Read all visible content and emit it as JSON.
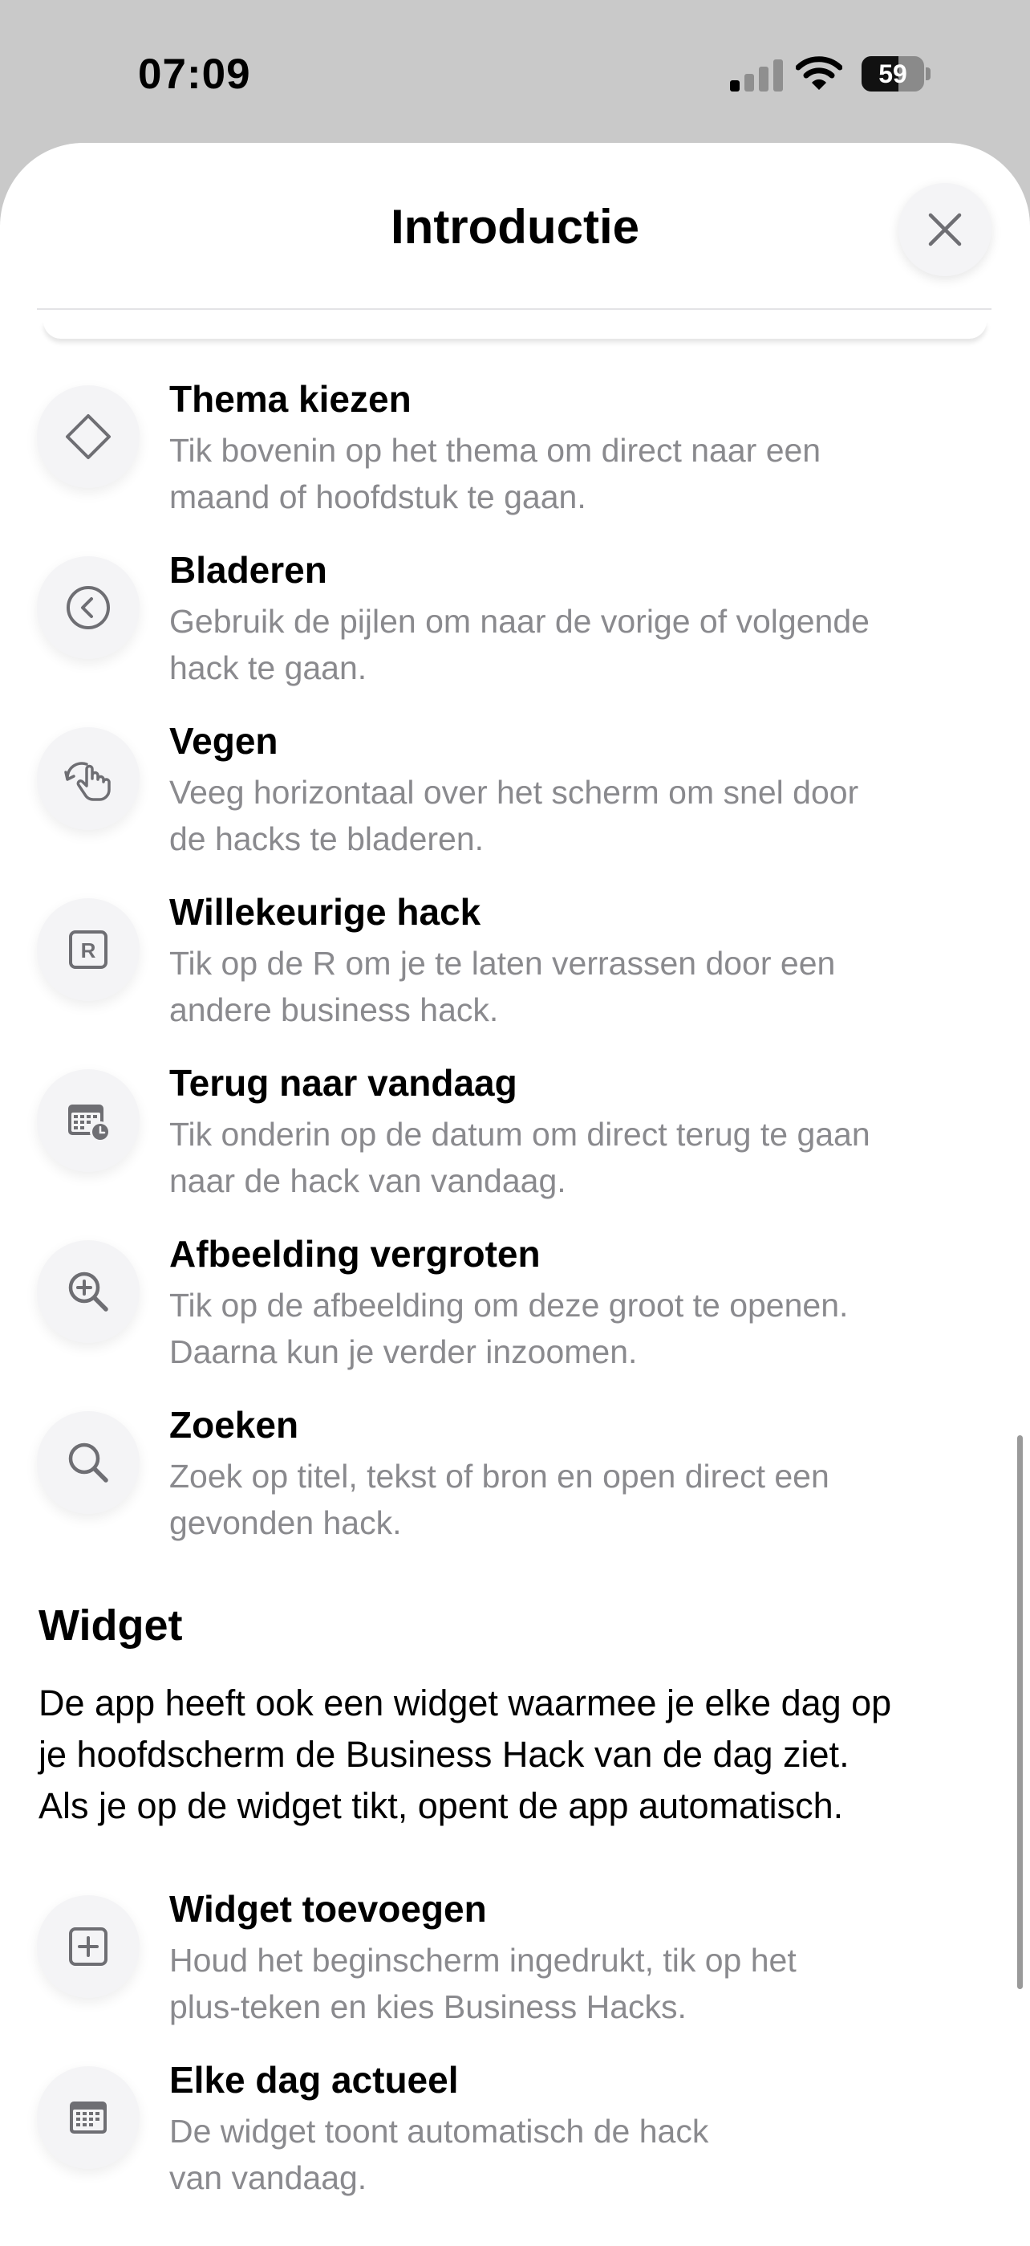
{
  "status_bar": {
    "time": "07:09",
    "battery": "59",
    "battery_level": 0.59
  },
  "sheet": {
    "title": "Introductie",
    "close_icon": "close-icon"
  },
  "items": [
    {
      "icon": "diamond-icon",
      "title": "Thema kiezen",
      "desc_1": "Tik bovenin op het thema om direct naar een",
      "desc_2": "maand of hoofdstuk te gaan."
    },
    {
      "icon": "chevron-left-circle-icon",
      "title": "Bladeren",
      "desc_1": "Gebruik de pijlen om naar de vorige of volgende",
      "desc_2": "hack te gaan."
    },
    {
      "icon": "swipe-hand-icon",
      "title": "Vegen",
      "desc_1": "Veeg horizontaal over het scherm om snel door",
      "desc_2": "de hacks te bladeren."
    },
    {
      "icon": "r-square-icon",
      "title": "Willekeurige hack",
      "desc_1": "Tik op de R om je te laten verrassen door een",
      "desc_2": "andere business hack."
    },
    {
      "icon": "calendar-clock-icon",
      "title": "Terug naar vandaag",
      "desc_1": "Tik onderin op de datum om direct terug te gaan",
      "desc_2": "naar de hack van vandaag."
    },
    {
      "icon": "zoom-in-icon",
      "title": "Afbeelding vergroten",
      "desc_1": "Tik op de afbeelding om deze groot te openen.",
      "desc_2": "Daarna kun je verder inzoomen."
    },
    {
      "icon": "search-icon",
      "title": "Zoeken",
      "desc_1": "Zoek op titel, tekst of bron en open direct een",
      "desc_2": "gevonden hack."
    }
  ],
  "widget_section": {
    "title": "Widget",
    "text_1": "De app heeft ook een widget waarmee je elke dag op",
    "text_2": "je hoofdscherm de Business Hack van de dag ziet.",
    "text_3": "Als je op de widget tikt, opent de app automatisch."
  },
  "widget_items": [
    {
      "icon": "plus-square-icon",
      "title": "Widget toevoegen",
      "desc_1": "Houd het beginscherm ingedrukt, tik op het",
      "desc_2": "plus-teken en kies Business Hacks."
    },
    {
      "icon": "calendar-icon",
      "title": "Elke dag actueel",
      "desc_1": "De widget toont automatisch de hack",
      "desc_2": "van vandaag."
    }
  ]
}
